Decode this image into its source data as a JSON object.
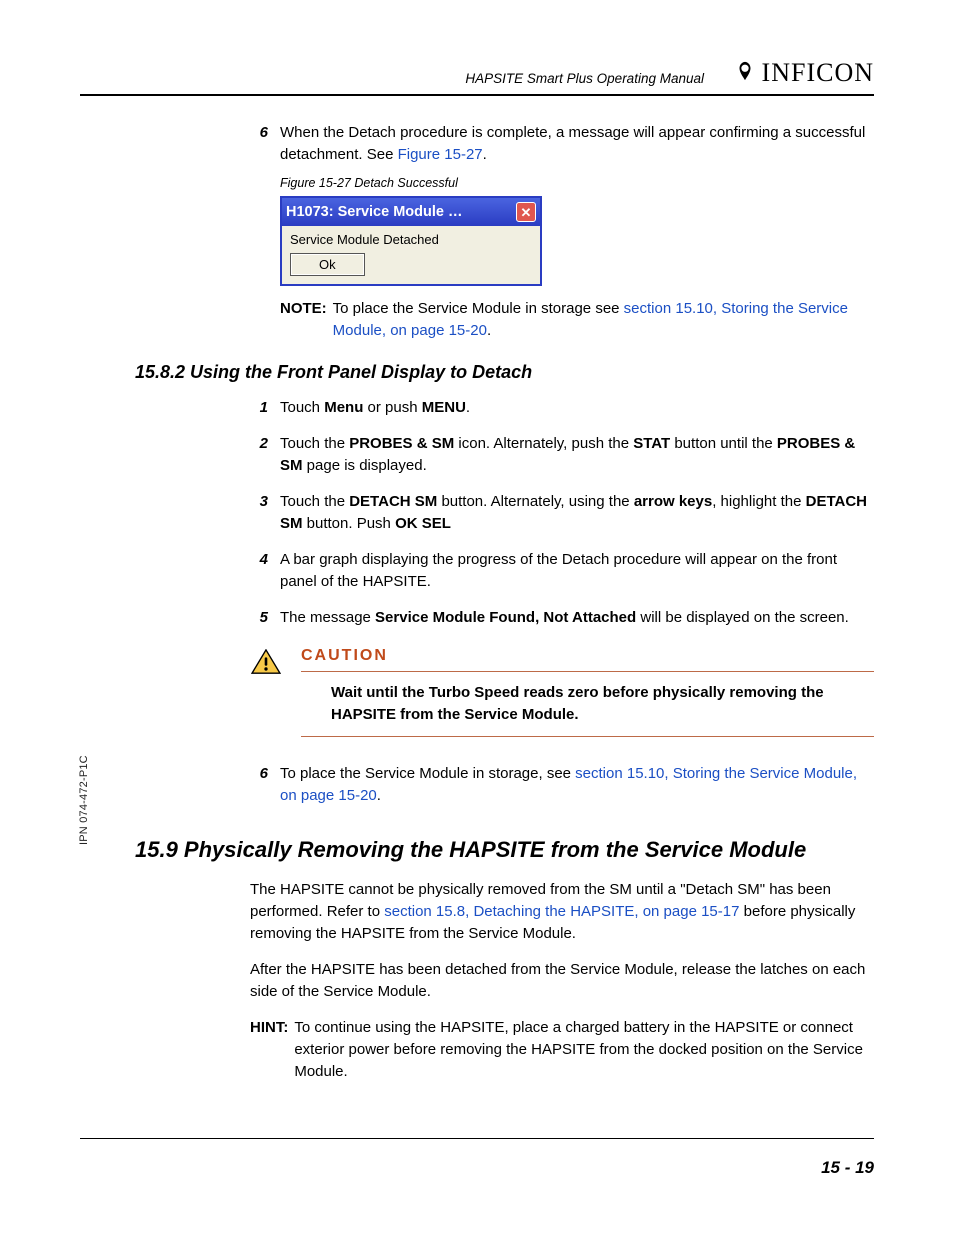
{
  "header": {
    "manual_title": "HAPSITE Smart Plus Operating Manual",
    "brand": "INFICON"
  },
  "step6_top": {
    "num": "6",
    "t1": "When the Detach procedure is complete, a message will appear confirming a successful detachment. See ",
    "ref": "Figure 15-27",
    "t2": "."
  },
  "figure": {
    "caption": "Figure 15-27  Detach Successful",
    "title": "H1073: Service Module …",
    "message": "Service Module Detached",
    "ok": "Ok"
  },
  "note_top": {
    "label": "NOTE:",
    "t1": "To place the Service Module in storage see ",
    "ref": "section 15.10, Storing the Service Module, on page 15-20",
    "t2": "."
  },
  "sec_1582": {
    "heading": "15.8.2  Using the Front Panel Display to Detach",
    "s1": {
      "num": "1",
      "a": "Touch ",
      "b": "Menu",
      "c": " or push ",
      "d": "MENU",
      "e": "."
    },
    "s2": {
      "num": "2",
      "a": "Touch the ",
      "b": "PROBES & SM",
      "c": " icon. Alternately, push the ",
      "d": "STAT",
      "e": " button until the ",
      "f": "PROBES & SM",
      "g": " page is displayed."
    },
    "s3": {
      "num": "3",
      "a": "Touch the ",
      "b": "DETACH SM",
      "c": " button. Alternately, using the ",
      "d": "arrow keys",
      "e": ", highlight the ",
      "f": "DETACH SM",
      "g": " button. Push ",
      "h": "OK SEL"
    },
    "s4": {
      "num": "4",
      "a": "A bar graph displaying the progress of the Detach procedure will appear on the front panel of the HAPSITE."
    },
    "s5": {
      "num": "5",
      "a": "The message ",
      "b": "Service Module Found, Not Attached",
      "c": " will be displayed on the screen."
    },
    "caution_heading": "CAUTION",
    "caution_text": "Wait until the Turbo Speed reads zero before physically removing the HAPSITE from the Service Module.",
    "s6": {
      "num": "6",
      "a": "To place the Service Module in storage, see ",
      "ref": "section 15.10, Storing the Service Module, on page 15-20",
      "b": "."
    }
  },
  "sec_159": {
    "heading": "15.9  Physically Removing the HAPSITE from the Service Module",
    "p1a": "The HAPSITE cannot be physically removed from the SM until a \"Detach SM\" has been performed. Refer to ",
    "p1ref": "section 15.8, Detaching the HAPSITE, on page 15-17",
    "p1b": " before physically removing the HAPSITE from the Service Module.",
    "p2": "After the HAPSITE has been detached from the Service Module, release the latches on each side of the Service Module.",
    "hint_label": "HINT:",
    "hint": "To continue using the HAPSITE, place a charged battery in the HAPSITE or connect exterior power before removing the HAPSITE from the docked position on the Service Module."
  },
  "footer": {
    "page": "15 - 19"
  },
  "side_code": "IPN 074-472-P1C"
}
